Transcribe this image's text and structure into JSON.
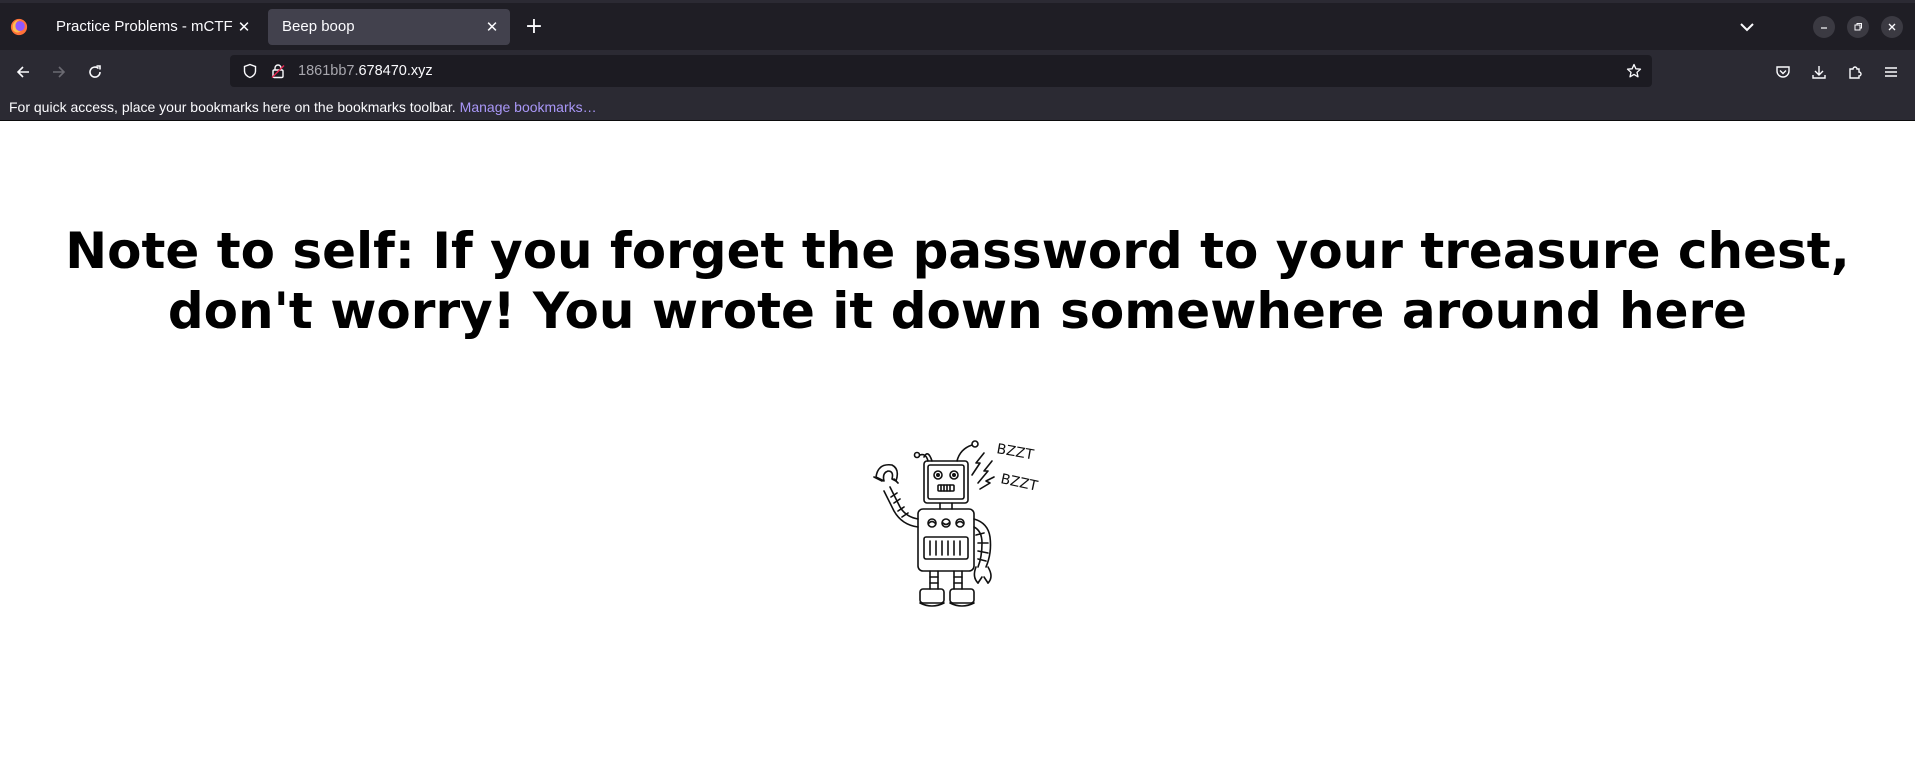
{
  "browser": {
    "tabs": [
      {
        "label": "Practice Problems - mCTF",
        "active": false
      },
      {
        "label": "Beep boop",
        "active": true
      }
    ],
    "url": {
      "host_prefix": "1861bb7.",
      "domain": "678470.xyz"
    },
    "bookmarks_toolbar": {
      "message": "For quick access, place your bookmarks here on the bookmarks toolbar.",
      "link": "Manage bookmarks…"
    },
    "icons": {
      "browser_logo": "firefox-logo-icon",
      "tab_close": "close-icon",
      "new_tab": "plus-icon",
      "tab_list": "chevron-down-icon",
      "minimize": "minimize-icon",
      "restore": "restore-icon",
      "close_window": "close-icon",
      "back": "back-arrow-icon",
      "forward": "forward-arrow-icon",
      "reload": "reload-icon",
      "tracking_protection": "shield-icon",
      "connection": "lock-icon",
      "bookmark": "star-icon",
      "pocket": "pocket-icon",
      "downloads": "download-icon",
      "extensions": "puzzle-icon",
      "menu": "hamburger-menu-icon"
    }
  },
  "page": {
    "heading_line1": "Note to self: If you forget the password to your treasure chest,",
    "heading_line2": "don't worry! You wrote it down somewhere around here",
    "robot_sound_1": "BZZT",
    "robot_sound_2": "BZZT"
  },
  "colors": {
    "titlebar_bg": "#1f1e25",
    "active_tab_bg": "#42414d",
    "toolbar_bg": "#2b2a33",
    "urlbar_bg": "#1c1b22",
    "link_color": "#a997f7"
  }
}
